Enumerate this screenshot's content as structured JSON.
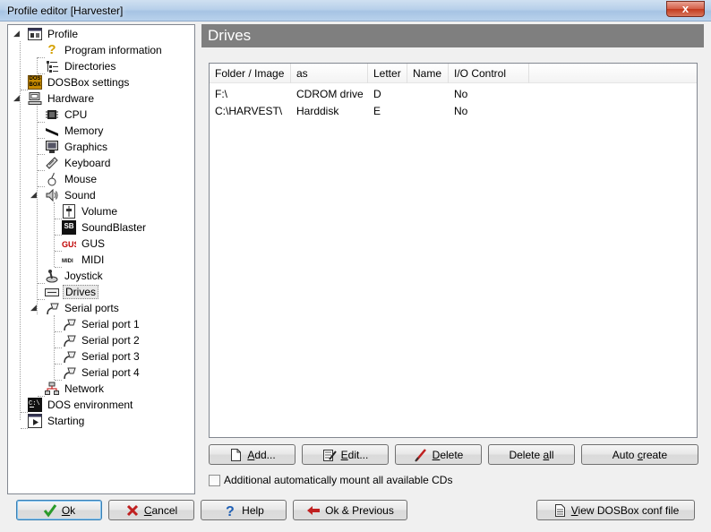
{
  "window": {
    "title": "Profile editor [Harvester]",
    "close_label": "x"
  },
  "tree": {
    "items": [
      {
        "label": "Profile",
        "icon": "profile-icon"
      },
      {
        "label": "Program information",
        "icon": "question-icon"
      },
      {
        "label": "Directories",
        "icon": "directories-icon"
      },
      {
        "label": "DOSBox settings",
        "icon": "dosbox-icon"
      },
      {
        "label": "Hardware",
        "icon": "computer-icon"
      },
      {
        "label": "CPU",
        "icon": "cpu-icon"
      },
      {
        "label": "Memory",
        "icon": "memory-icon"
      },
      {
        "label": "Graphics",
        "icon": "monitor-icon"
      },
      {
        "label": "Keyboard",
        "icon": "keyboard-icon"
      },
      {
        "label": "Mouse",
        "icon": "mouse-icon"
      },
      {
        "label": "Sound",
        "icon": "speaker-icon"
      },
      {
        "label": "Volume",
        "icon": "volume-icon"
      },
      {
        "label": "SoundBlaster",
        "icon": "soundblaster-icon"
      },
      {
        "label": "GUS",
        "icon": "gus-icon"
      },
      {
        "label": "MIDI",
        "icon": "midi-icon"
      },
      {
        "label": "Joystick",
        "icon": "joystick-icon"
      },
      {
        "label": "Drives",
        "icon": "drive-icon"
      },
      {
        "label": "Serial ports",
        "icon": "serial-icon"
      },
      {
        "label": "Serial port 1",
        "icon": "serial-icon"
      },
      {
        "label": "Serial port 2",
        "icon": "serial-icon"
      },
      {
        "label": "Serial port 3",
        "icon": "serial-icon"
      },
      {
        "label": "Serial port 4",
        "icon": "serial-icon"
      },
      {
        "label": "Network",
        "icon": "network-icon"
      },
      {
        "label": "DOS environment",
        "icon": "dos-prompt-icon"
      },
      {
        "label": "Starting",
        "icon": "start-icon"
      }
    ],
    "selected": "Drives"
  },
  "panel": {
    "title": "Drives"
  },
  "drives_table": {
    "columns": [
      "Folder / Image",
      "as",
      "Letter",
      "Name",
      "I/O Control"
    ],
    "rows": [
      {
        "folder": "F:\\",
        "as": "CDROM drive",
        "letter": "D",
        "name": "",
        "io": "No"
      },
      {
        "folder": "C:\\HARVEST\\",
        "as": "Harddisk",
        "letter": "E",
        "name": "",
        "io": "No"
      }
    ]
  },
  "drive_buttons": {
    "add_pre": "",
    "add_u": "A",
    "add_post": "dd...",
    "edit_pre": "",
    "edit_u": "E",
    "edit_post": "dit...",
    "delete_pre": "",
    "delete_u": "D",
    "delete_post": "elete",
    "deleteall_pre": "Delete ",
    "deleteall_u": "a",
    "deleteall_post": "ll",
    "autocreate_pre": "Auto ",
    "autocreate_u": "c",
    "autocreate_post": "reate"
  },
  "checkbox": {
    "label": "Additional automatically mount all available CDs",
    "checked": false
  },
  "footer": {
    "ok_pre": "",
    "ok_u": "O",
    "ok_post": "k",
    "cancel_pre": "",
    "cancel_u": "C",
    "cancel_post": "ancel",
    "help_label": "Help",
    "ok_previous_label": "Ok & Previous",
    "view_pre": "",
    "view_u": "V",
    "view_post": "iew DOSBox conf file"
  },
  "colors": {
    "header_band": "#7f7f7f",
    "ok_check": "#2a9a2a",
    "cancel_x": "#c02020"
  }
}
